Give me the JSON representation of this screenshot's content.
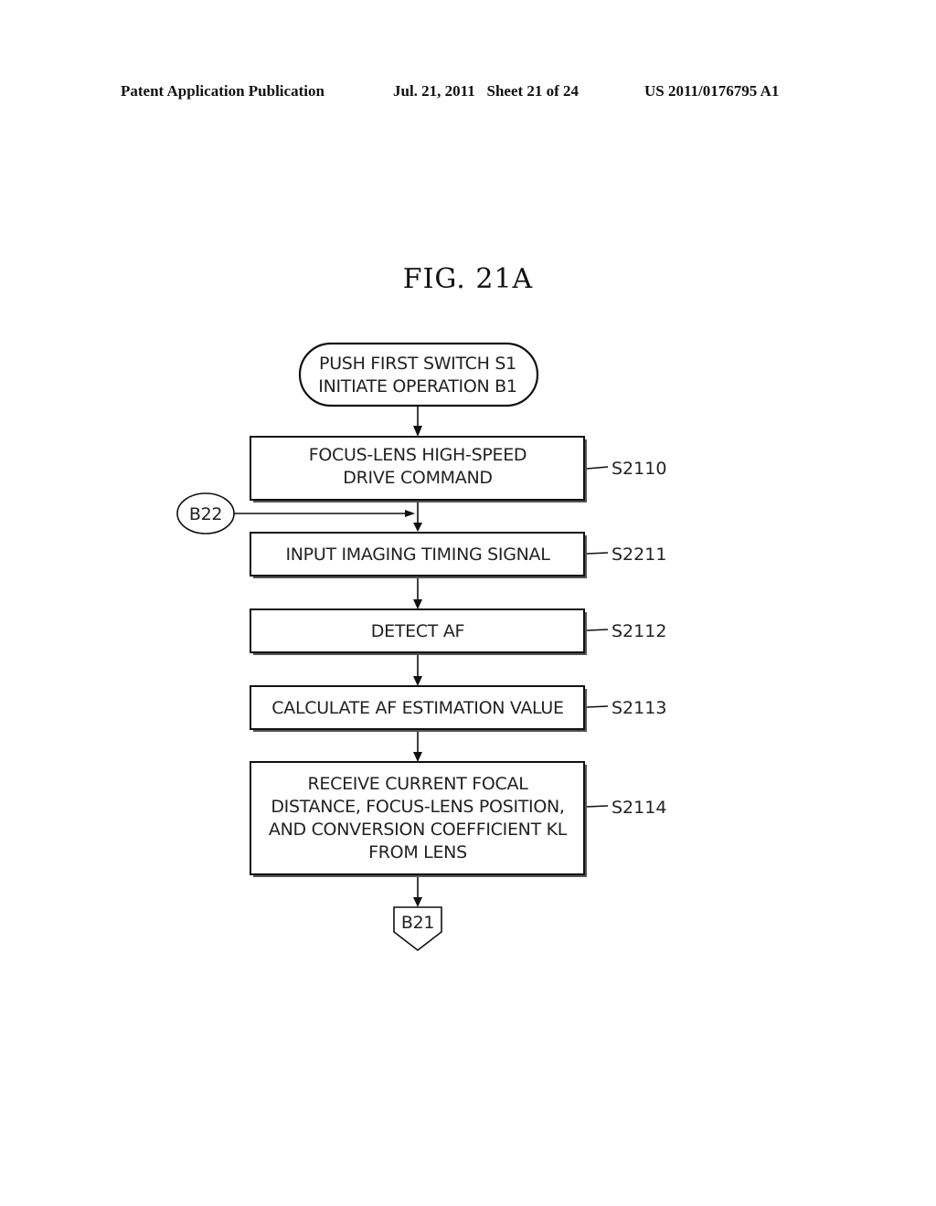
{
  "header": {
    "publication": "Patent Application Publication",
    "date_sheet": "Jul. 21, 2011   Sheet 21 of 24",
    "number": "US 2011/0176795 A1"
  },
  "figure": {
    "title": "FIG. 21A",
    "start": {
      "lines": [
        "PUSH FIRST SWITCH S1",
        "INITIATE OPERATION B1"
      ]
    },
    "steps": [
      {
        "id": "S2110",
        "lines": [
          "FOCUS-LENS HIGH-SPEED",
          "DRIVE COMMAND"
        ]
      },
      {
        "id": "S2211",
        "lines": [
          "INPUT IMAGING TIMING SIGNAL"
        ]
      },
      {
        "id": "S2112",
        "lines": [
          "DETECT AF"
        ]
      },
      {
        "id": "S2113",
        "lines": [
          "CALCULATE AF ESTIMATION VALUE"
        ]
      },
      {
        "id": "S2114",
        "lines": [
          "RECEIVE CURRENT FOCAL",
          "DISTANCE, FOCUS-LENS POSITION,",
          "AND CONVERSION COEFFICIENT KL",
          "FROM LENS"
        ]
      }
    ],
    "connector_in": "B22",
    "connector_out": "B21"
  }
}
